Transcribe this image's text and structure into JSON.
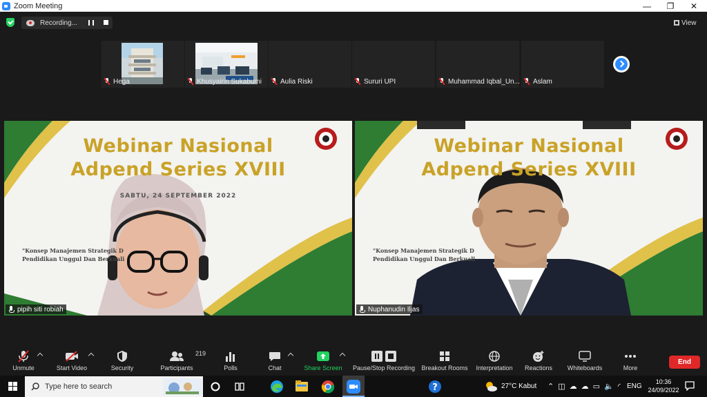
{
  "window": {
    "title": "Zoom Meeting"
  },
  "recording": {
    "label": "Recording..."
  },
  "view": {
    "label": "View"
  },
  "thumbnails": [
    {
      "name": "Hega"
    },
    {
      "name": "Khusyairin Sukabumi"
    },
    {
      "name": "Aulia Riski"
    },
    {
      "name": "Sururi UPI"
    },
    {
      "name": "Muhammad Iqbal_Un..."
    },
    {
      "name": "Aslam"
    }
  ],
  "slide": {
    "title_line1": "Webinar Nasional",
    "title_line2": "Adpend Series XVIII",
    "date": "SABTU, 24 SEPTEMBER 2022",
    "sub_line1": "\"Konsep Manajemen Strategik D",
    "sub_line2": "Pendidikan Unggul Dan Berkuali"
  },
  "videos": [
    {
      "name": "pipih siti robiah"
    },
    {
      "name": "Nuphanudin Iljas"
    }
  ],
  "toolbar": {
    "unmute": "Unmute",
    "start_video": "Start Video",
    "security": "Security",
    "participants": "Participants",
    "participants_count": "219",
    "polls": "Polls",
    "chat": "Chat",
    "share_screen": "Share Screen",
    "pause_stop_recording": "Pause/Stop Recording",
    "breakout_rooms": "Breakout Rooms",
    "interpretation": "Interpretation",
    "reactions": "Reactions",
    "whiteboards": "Whiteboards",
    "more": "More",
    "end": "End"
  },
  "taskbar": {
    "search_placeholder": "Type here to search",
    "weather": "27°C  Kabut",
    "language": "ENG",
    "time": "10:36",
    "date": "24/09/2022"
  },
  "colors": {
    "zoom_blue": "#2d8cff",
    "end_red": "#e02828",
    "share_green": "#23d160",
    "slide_gold": "#c9a227",
    "slide_green": "#2e7d32"
  }
}
